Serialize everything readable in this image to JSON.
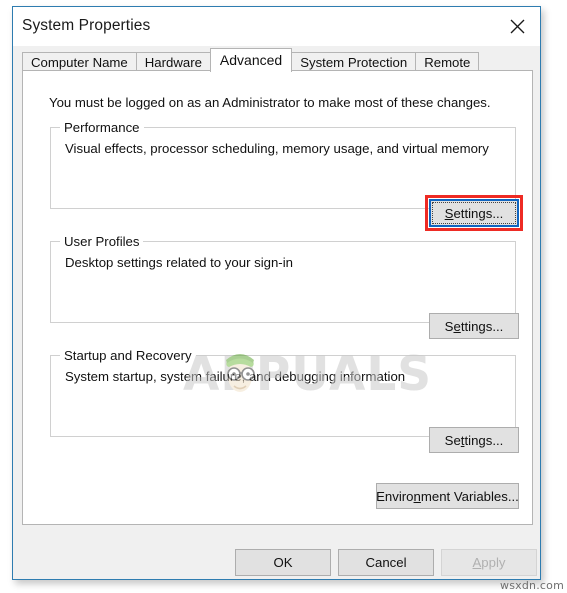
{
  "window": {
    "title": "System Properties",
    "close_icon": "close-icon",
    "border_color": "#2e7cb0"
  },
  "tabs": [
    {
      "label": "Computer Name",
      "active": false
    },
    {
      "label": "Hardware",
      "active": false
    },
    {
      "label": "Advanced",
      "active": true
    },
    {
      "label": "System Protection",
      "active": false
    },
    {
      "label": "Remote",
      "active": false
    }
  ],
  "advanced_tab": {
    "admin_note": "You must be logged on as an Administrator to make most of these changes.",
    "groups": [
      {
        "title": "Performance",
        "description": "Visual effects, processor scheduling, memory usage, and virtual memory",
        "button": {
          "label": "Settings...",
          "accel_index": 0,
          "highlighted": true,
          "focused": true
        }
      },
      {
        "title": "User Profiles",
        "description": "Desktop settings related to your sign-in",
        "button": {
          "label": "Settings...",
          "accel_index": 1,
          "highlighted": false,
          "focused": false
        }
      },
      {
        "title": "Startup and Recovery",
        "description": "System startup, system failure, and debugging information",
        "button": {
          "label": "Settings...",
          "accel_index": 2,
          "highlighted": false,
          "focused": false
        }
      }
    ],
    "env_button": {
      "label": "Environment Variables...",
      "accel_index": 6
    }
  },
  "footer": {
    "ok_label": "OK",
    "cancel_label": "Cancel",
    "apply_label": "Apply",
    "apply_disabled": true
  },
  "watermarks": {
    "appuals": "APPUALS",
    "site": "wsxdn.com"
  },
  "colors": {
    "highlight_red": "#ee2b24",
    "focus_blue": "#1065c0",
    "title_bar": "#ffffff",
    "dialog_face": "#f0f0f0"
  }
}
